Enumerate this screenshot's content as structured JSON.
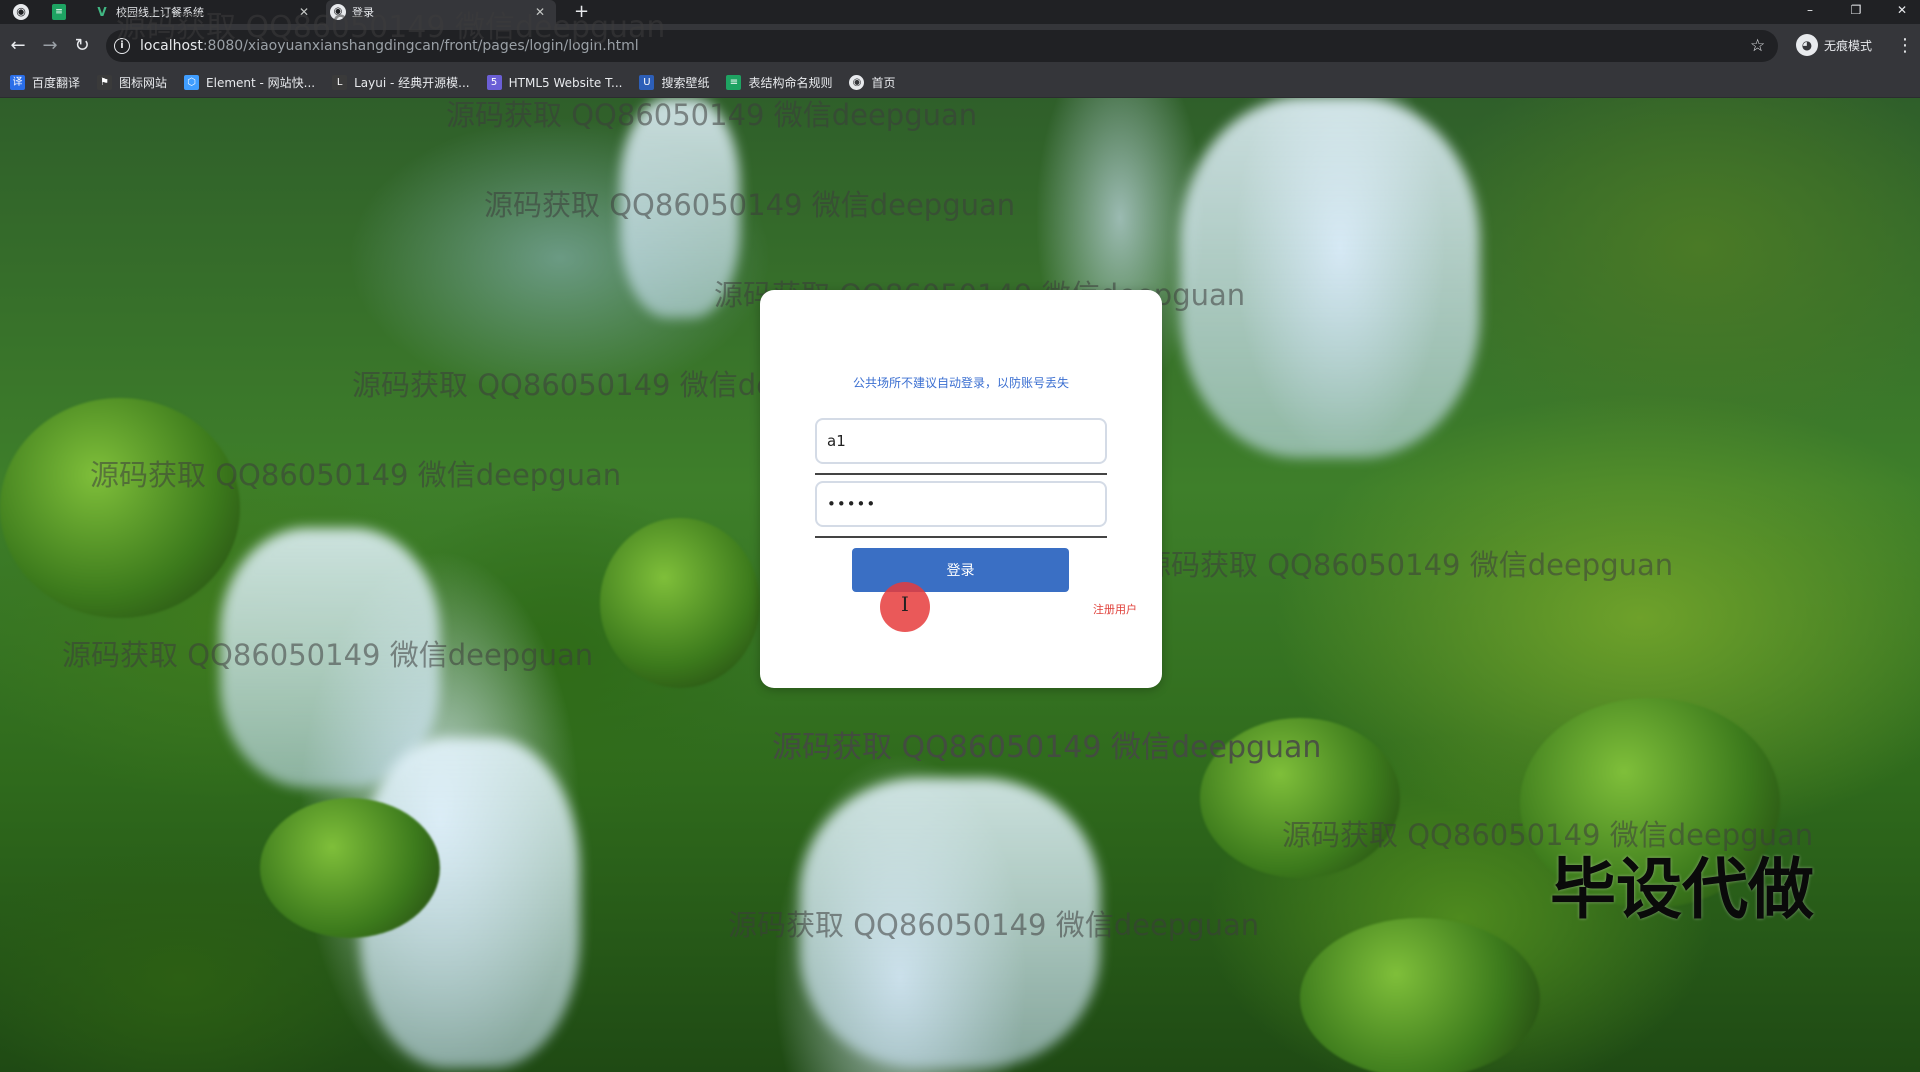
{
  "browser": {
    "tabs": [
      {
        "title": "校园线上订餐系统",
        "favicon": "vue-icon"
      },
      {
        "title": "登录",
        "favicon": "globe-icon"
      }
    ],
    "new_tab": "+",
    "window_controls": {
      "minimize": "–",
      "maximize": "❐",
      "close": "✕"
    },
    "url_host": "localhost",
    "url_path": ":8080/xiaoyuanxianshangdingcan/front/pages/login/login.html",
    "profile_label": "无痕模式"
  },
  "bookmarks": [
    {
      "label": "百度翻译",
      "icon": "translate-icon",
      "color": "#2a6ee8"
    },
    {
      "label": "图标网站",
      "icon": "flag-icon",
      "color": "#3a3a3a"
    },
    {
      "label": "Element - 网站快...",
      "icon": "element-icon",
      "color": "#409eff"
    },
    {
      "label": "Layui - 经典开源模...",
      "icon": "layui-icon",
      "color": "#3a3a3a"
    },
    {
      "label": "HTML5 Website T...",
      "icon": "html5-icon",
      "color": "#6b5fd6"
    },
    {
      "label": "搜索壁纸",
      "icon": "wallpaper-icon",
      "color": "#2d5fb8"
    },
    {
      "label": "表结构命名规则",
      "icon": "sheet-icon",
      "color": "#1ea362"
    },
    {
      "label": "首页",
      "icon": "globe-icon",
      "color": "#e8eaed"
    }
  ],
  "login": {
    "tip": "公共场所不建议自动登录，以防账号丢失",
    "username": "a1",
    "password_mask": "•••••",
    "login_button": "登录",
    "register_link": "注册用户"
  },
  "watermark": {
    "text": "源码获取 QQ86050149 微信deepguan",
    "corner": "毕设代做"
  }
}
